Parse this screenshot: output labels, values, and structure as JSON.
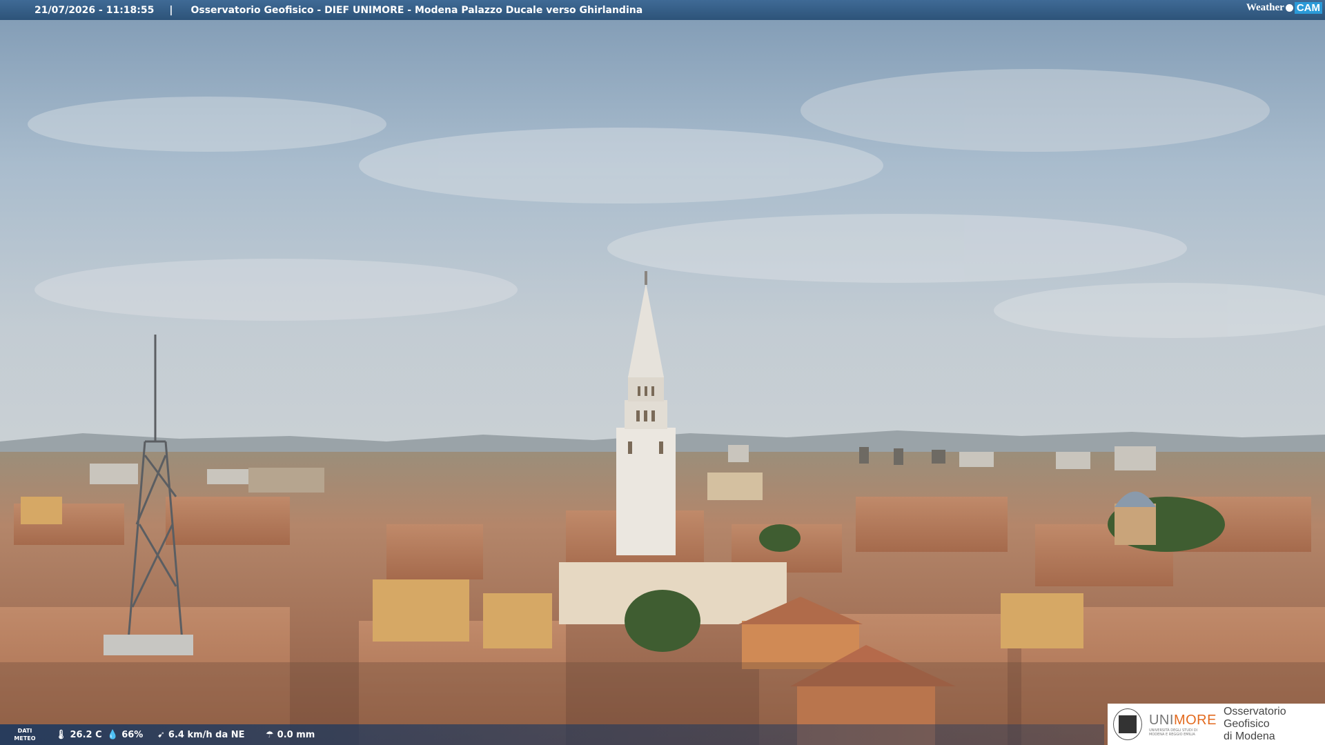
{
  "header": {
    "timestamp": "21/07/2026 - 11:18:55",
    "separator": "|",
    "title": "Osservatorio Geofisico - DIEF UNIMORE - Modena Palazzo Ducale verso Ghirlandina",
    "brand_weather": "Weather",
    "brand_cam": "CAM"
  },
  "weather": {
    "label": "DATI METEO",
    "temperature": "26.2 C",
    "humidity": "66%",
    "wind": "6.4 km/h da NE",
    "rain": "0.0 mm"
  },
  "logo": {
    "unimore_prefix": "UNI",
    "unimore_suffix": "MORE",
    "unimore_subtitle": "UNIVERSITÀ DEGLI STUDI DI MODENA E REGGIO EMILIA",
    "line1": "Osservatorio Geofisico",
    "line2": "di Modena"
  },
  "colors": {
    "bar": "#2d5379",
    "brand_accent": "#2b9ad8",
    "unimore_orange": "#e36a1e"
  }
}
